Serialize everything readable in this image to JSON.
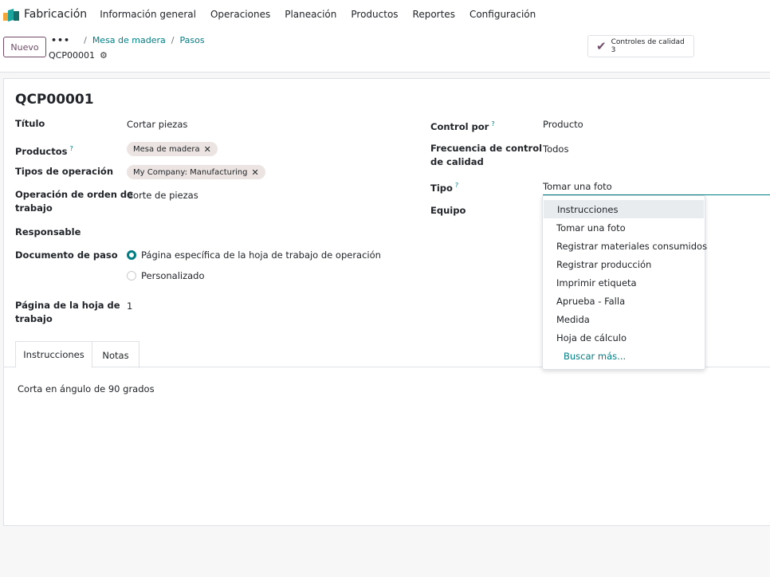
{
  "navbar": {
    "brand": "Fabricación",
    "menu": [
      "Información general",
      "Operaciones",
      "Planeación",
      "Productos",
      "Reportes",
      "Configuración"
    ]
  },
  "control": {
    "new_label": "Nuevo",
    "breadcrumb_dots": "•••",
    "breadcrumb": [
      "Mesa de madera",
      "Pasos"
    ],
    "record": "QCP00001",
    "smart_button": {
      "label": "Controles de calidad",
      "count": "3"
    }
  },
  "form": {
    "title": "QCP00001",
    "left": {
      "titulo_label": "Título",
      "titulo_value": "Cortar piezas",
      "productos_label": "Productos",
      "productos_tag": "Mesa de madera",
      "tipos_label": "Tipos de operación",
      "tipos_tag": "My Company: Manufacturing",
      "operacion_label_1": "Operación de orden de",
      "operacion_label_2": "trabajo",
      "operacion_value": "Corte de piezas",
      "responsable_label": "Responsable",
      "documento_label": "Documento de paso",
      "documento_option_1": "Página específica de la hoja de trabajo de operación",
      "documento_option_2": "Personalizado",
      "pagina_label_1": "Página de la hoja de",
      "pagina_label_2": "trabajo",
      "pagina_value": "1"
    },
    "right": {
      "control_label": "Control por",
      "control_value": "Producto",
      "frecuencia_label_1": "Frecuencia de control",
      "frecuencia_label_2": "de calidad",
      "frecuencia_value": "Todos",
      "tipo_label": "Tipo",
      "tipo_value": "Tomar una foto",
      "equipo_label": "Equipo"
    },
    "help_mark": "?",
    "tabs": [
      "Instrucciones",
      "Notas"
    ],
    "instructions": "Corta en ángulo de 90 grados"
  },
  "dropdown": {
    "options": [
      "Instrucciones",
      "Tomar una foto",
      "Registrar materiales consumidos",
      "Registrar producción",
      "Imprimir etiqueta",
      "Aprueba - Falla",
      "Medida",
      "Hoja de cálculo"
    ],
    "search_more": "Buscar más..."
  },
  "colors": {
    "primary": "#714b67",
    "link": "#017e84"
  }
}
